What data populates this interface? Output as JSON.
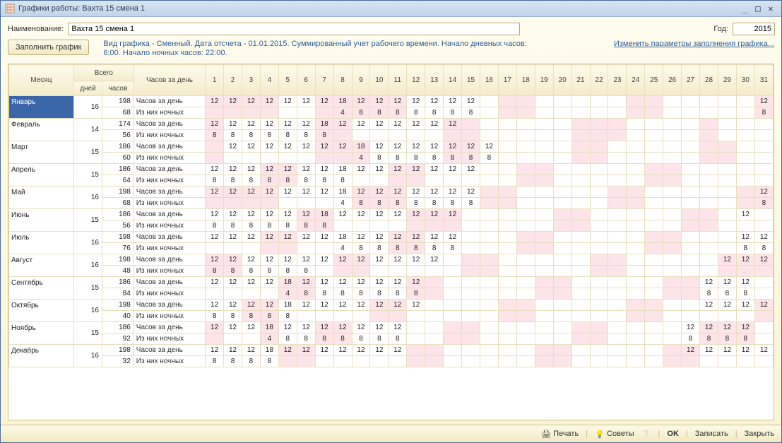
{
  "window": {
    "title": "Графики работы: Вахта 15 смена 1"
  },
  "form": {
    "name_label": "Наименование:",
    "name_value": "Вахта 15 смена 1",
    "year_label": "Год:",
    "year_value": "2015",
    "fill_button": "Заполнить график",
    "info_text": "Вид графика - Сменный. Дата отсчета - 01.01.2015. Суммированный учет рабочего времени. Начало дневных часов: 6:00. Начало ночных часов: 22:00.",
    "change_link": "Изменить параметры заполнения графика..."
  },
  "headers": {
    "month": "Месяц",
    "total": "Всего",
    "days": "дней",
    "hours": "часов",
    "hpd": "Часов за день",
    "row_day": "Часов за день",
    "row_night": "Из них ночных"
  },
  "chart_data": {
    "type": "table",
    "title": "Графики работы: Вахта 15 смена 1 — 2015",
    "weekends": {
      "Январь": [
        1,
        2,
        3,
        4,
        7,
        8,
        9,
        10,
        11,
        17,
        18,
        24,
        25,
        31
      ],
      "Февраль": [
        1,
        7,
        8,
        14,
        15,
        21,
        22,
        23,
        28
      ],
      "Март": [
        1,
        7,
        8,
        9,
        14,
        15,
        21,
        22,
        28,
        29
      ],
      "Апрель": [
        4,
        5,
        11,
        12,
        18,
        19,
        25,
        26
      ],
      "Май": [
        1,
        2,
        3,
        4,
        9,
        10,
        11,
        16,
        17,
        23,
        24,
        30,
        31
      ],
      "Июнь": [
        6,
        7,
        12,
        13,
        14,
        20,
        21,
        27,
        28
      ],
      "Июль": [
        4,
        5,
        11,
        12,
        18,
        19,
        25,
        26
      ],
      "Август": [
        1,
        2,
        8,
        9,
        15,
        16,
        22,
        23,
        29,
        30,
        31
      ],
      "Сентябрь": [
        5,
        6,
        12,
        13,
        19,
        20,
        26,
        27
      ],
      "Октябрь": [
        3,
        4,
        10,
        11,
        17,
        18,
        24,
        25,
        31
      ],
      "Ноябрь": [
        1,
        4,
        7,
        8,
        14,
        15,
        21,
        22,
        28,
        29,
        30
      ],
      "Декабрь": [
        5,
        6,
        12,
        13,
        19,
        20,
        26,
        27
      ]
    },
    "months": [
      {
        "name": "Январь",
        "selected": true,
        "days": 16,
        "hours": 198,
        "night": 68,
        "h": {
          "1": 12,
          "2": 12,
          "3": 12,
          "4": 12,
          "5": 12,
          "6": 12,
          "7": 12,
          "8": 18,
          "9": 12,
          "10": 12,
          "11": 12,
          "12": 12,
          "13": 12,
          "14": 12,
          "15": 12,
          "31": 12
        },
        "n": {
          "8": 4,
          "9": 8,
          "10": 8,
          "11": 8,
          "12": 8,
          "13": 8,
          "14": 8,
          "15": 8,
          "31": 8
        }
      },
      {
        "name": "Февраль",
        "days": 14,
        "hours": 174,
        "night": 56,
        "h": {
          "1": 12,
          "2": 12,
          "3": 12,
          "4": 12,
          "5": 12,
          "6": 12,
          "7": 18,
          "8": 12,
          "9": 12,
          "10": 12,
          "11": 12,
          "12": 12,
          "13": 12,
          "14": 12
        },
        "n": {
          "1": 8,
          "2": 8,
          "3": 8,
          "4": 8,
          "5": 8,
          "6": 8,
          "7": 8
        }
      },
      {
        "name": "Март",
        "days": 15,
        "hours": 186,
        "night": 60,
        "h": {
          "2": 12,
          "3": 12,
          "4": 12,
          "5": 12,
          "6": 12,
          "7": 12,
          "8": 12,
          "9": 18,
          "10": 12,
          "11": 12,
          "12": 12,
          "13": 12,
          "14": 12,
          "15": 12,
          "16": 12
        },
        "n": {
          "9": 4,
          "10": 8,
          "11": 8,
          "12": 8,
          "13": 8,
          "14": 8,
          "15": 8,
          "16": 8
        }
      },
      {
        "name": "Апрель",
        "days": 15,
        "hours": 186,
        "night": 64,
        "h": {
          "1": 12,
          "2": 12,
          "3": 12,
          "4": 12,
          "5": 12,
          "6": 12,
          "7": 12,
          "8": 18,
          "9": 12,
          "10": 12,
          "11": 12,
          "12": 12,
          "13": 12,
          "14": 12,
          "15": 12
        },
        "n": {
          "1": 8,
          "2": 8,
          "3": 8,
          "4": 8,
          "5": 8,
          "6": 8,
          "7": 8,
          "8": 8
        }
      },
      {
        "name": "Май",
        "days": 16,
        "hours": 198,
        "night": 68,
        "h": {
          "1": 12,
          "2": 12,
          "3": 12,
          "4": 12,
          "5": 12,
          "6": 12,
          "7": 12,
          "8": 18,
          "9": 12,
          "10": 12,
          "11": 12,
          "12": 12,
          "13": 12,
          "14": 12,
          "15": 12,
          "31": 12
        },
        "n": {
          "8": 4,
          "9": 8,
          "10": 8,
          "11": 8,
          "12": 8,
          "13": 8,
          "14": 8,
          "15": 8,
          "31": 8
        }
      },
      {
        "name": "Июнь",
        "days": 15,
        "hours": 186,
        "night": 56,
        "h": {
          "1": 12,
          "2": 12,
          "3": 12,
          "4": 12,
          "5": 12,
          "6": 12,
          "7": 18,
          "8": 12,
          "9": 12,
          "10": 12,
          "11": 12,
          "12": 12,
          "13": 12,
          "14": 12,
          "30": 12
        },
        "n": {
          "1": 8,
          "2": 8,
          "3": 8,
          "4": 8,
          "5": 8,
          "6": 8,
          "7": 8
        }
      },
      {
        "name": "Июль",
        "days": 16,
        "hours": 198,
        "night": 76,
        "h": {
          "1": 12,
          "2": 12,
          "3": 12,
          "4": 12,
          "5": 12,
          "6": 12,
          "7": 12,
          "8": 18,
          "9": 12,
          "10": 12,
          "11": 12,
          "12": 12,
          "13": 12,
          "14": 12,
          "30": 12,
          "31": 12
        },
        "n": {
          "8": 4,
          "9": 8,
          "10": 8,
          "11": 8,
          "12": 8,
          "13": 8,
          "14": 8,
          "30": 8,
          "31": 8
        }
      },
      {
        "name": "Август",
        "days": 16,
        "hours": 198,
        "night": 48,
        "h": {
          "1": 12,
          "2": 12,
          "3": 12,
          "4": 12,
          "5": 12,
          "6": 12,
          "7": 12,
          "8": 12,
          "9": 12,
          "10": 12,
          "11": 12,
          "12": 12,
          "13": 12,
          "29": 12,
          "30": 12,
          "31": 12
        },
        "n": {
          "1": 8,
          "2": 8,
          "3": 8,
          "4": 8,
          "5": 8,
          "6": 8
        }
      },
      {
        "name": "Сентябрь",
        "days": 15,
        "hours": 186,
        "night": 84,
        "h": {
          "1": 12,
          "2": 12,
          "3": 12,
          "4": 12,
          "5": 18,
          "6": 12,
          "7": 12,
          "8": 12,
          "9": 12,
          "10": 12,
          "11": 12,
          "12": 12,
          "28": 12,
          "29": 12,
          "30": 12
        },
        "n": {
          "5": 4,
          "6": 8,
          "7": 8,
          "8": 8,
          "9": 8,
          "10": 8,
          "11": 8,
          "12": 8,
          "28": 8,
          "29": 8,
          "30": 8
        }
      },
      {
        "name": "Октябрь",
        "days": 16,
        "hours": 198,
        "night": 40,
        "h": {
          "1": 12,
          "2": 12,
          "3": 12,
          "4": 12,
          "5": 18,
          "6": 12,
          "7": 12,
          "8": 12,
          "9": 12,
          "10": 12,
          "11": 12,
          "12": 12,
          "28": 12,
          "29": 12,
          "30": 12,
          "31": 12
        },
        "n": {
          "1": 8,
          "2": 8,
          "3": 8,
          "4": 8,
          "5": 8
        }
      },
      {
        "name": "Ноябрь",
        "days": 15,
        "hours": 186,
        "night": 92,
        "h": {
          "1": 12,
          "2": 12,
          "3": 12,
          "4": 18,
          "5": 12,
          "6": 12,
          "7": 12,
          "8": 12,
          "9": 12,
          "10": 12,
          "11": 12,
          "27": 12,
          "28": 12,
          "29": 12,
          "30": 12
        },
        "n": {
          "4": 4,
          "5": 8,
          "6": 8,
          "7": 8,
          "8": 8,
          "9": 8,
          "10": 8,
          "11": 8,
          "27": 8,
          "28": 8,
          "29": 8,
          "30": 8
        }
      },
      {
        "name": "Декабрь",
        "days": 16,
        "hours": 198,
        "night": 32,
        "h": {
          "1": 12,
          "2": 12,
          "3": 12,
          "4": 18,
          "5": 12,
          "6": 12,
          "7": 12,
          "8": 12,
          "9": 12,
          "10": 12,
          "11": 12,
          "27": 12,
          "28": 12,
          "29": 12,
          "30": 12,
          "31": 12
        },
        "n": {
          "1": 8,
          "2": 8,
          "3": 8,
          "4": 8
        }
      }
    ]
  },
  "footer": {
    "print": "Печать",
    "tips": "Советы",
    "ok": "OK",
    "save": "Записать",
    "close": "Закрыть"
  }
}
